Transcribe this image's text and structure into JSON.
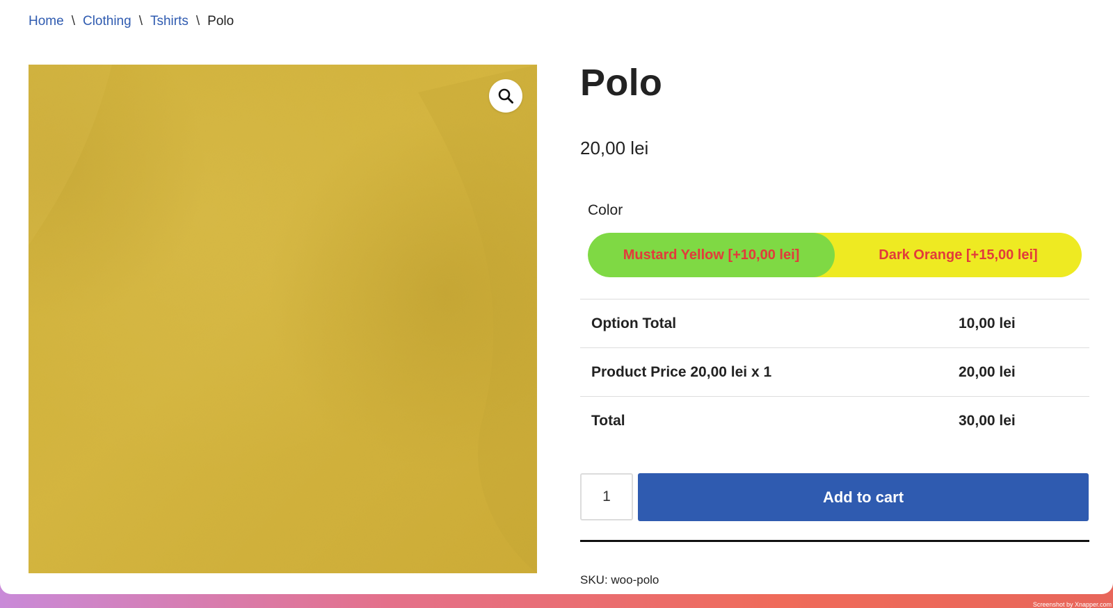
{
  "breadcrumb": {
    "items": [
      {
        "label": "Home",
        "link": true
      },
      {
        "label": "Clothing",
        "link": true
      },
      {
        "label": "Tshirts",
        "link": true
      },
      {
        "label": "Polo",
        "link": false
      }
    ],
    "separator": "\\"
  },
  "product": {
    "title": "Polo",
    "price": "20,00 lei",
    "image_color": "#d8b93f",
    "zoom_icon": "magnifier-icon"
  },
  "options": {
    "color_label": "Color",
    "swatches": [
      {
        "label": "Mustard Yellow [+10,00 lei]",
        "color": "#7fd944",
        "selected": true
      },
      {
        "label": "Dark Orange [+15,00 lei]",
        "color": "#eeea22",
        "selected": false
      }
    ],
    "text_color": "#e23b3b"
  },
  "totals": {
    "rows": [
      {
        "label": "Option Total",
        "value": "10,00 lei"
      },
      {
        "label": "Product Price 20,00 lei x 1",
        "value": "20,00 lei"
      },
      {
        "label": "Total",
        "value": "30,00 lei"
      }
    ]
  },
  "cart": {
    "quantity": "1",
    "add_label": "Add to cart",
    "button_color": "#2f5bb0"
  },
  "meta": {
    "sku": "SKU: woo-polo"
  },
  "watermark": "Screenshot by Xnapper.com"
}
